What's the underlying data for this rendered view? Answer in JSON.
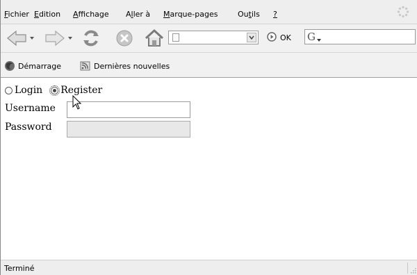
{
  "menu": {
    "items": [
      {
        "pre": "",
        "acc": "F",
        "post": "ichier"
      },
      {
        "pre": "",
        "acc": "E",
        "post": "dition"
      },
      {
        "pre": "",
        "acc": "A",
        "post": "ffichage"
      },
      {
        "pre": "A",
        "acc": "l",
        "post": "ler à"
      },
      {
        "pre": "",
        "acc": "M",
        "post": "arque-pages"
      },
      {
        "pre": "Ou",
        "acc": "t",
        "post": "ils"
      },
      {
        "pre": "",
        "acc": "?",
        "post": ""
      }
    ]
  },
  "navigation": {
    "url_value": "",
    "go_label": "OK",
    "search_engine_glyph": "G",
    "search_value": ""
  },
  "bookmarks": {
    "items": [
      {
        "label": "Démarrage",
        "icon": "firefox-logo-icon"
      },
      {
        "label": "Dernières nouvelles",
        "icon": "rss-feed-icon"
      }
    ]
  },
  "form": {
    "radio_login_label": "Login",
    "radio_register_label": "Register",
    "selected": "register",
    "username_label": "Username",
    "username_value": "",
    "password_label": "Password",
    "password_value": ""
  },
  "status": {
    "text": "Terminé"
  }
}
